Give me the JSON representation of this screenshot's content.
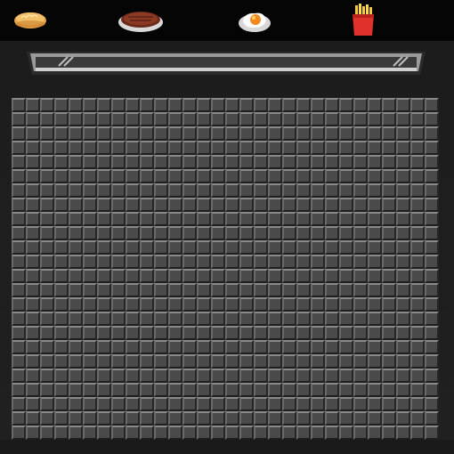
{
  "food_bar": {
    "items": [
      {
        "id": "bread",
        "icon": "bread-icon"
      },
      {
        "id": "steak",
        "icon": "steak-icon"
      },
      {
        "id": "egg",
        "icon": "fried-egg-icon"
      },
      {
        "id": "fries",
        "icon": "fries-icon"
      }
    ]
  },
  "griddle": {
    "columns": 30,
    "rows": 24
  },
  "colors": {
    "bar_bg": "#050505",
    "cabinet_bg": "#202020",
    "tile_face": "#4a4a4a",
    "tile_highlight": "#8a8a8a",
    "tile_shadow": "#1e1e1e",
    "drawer_metal": "#9a9a9a"
  }
}
